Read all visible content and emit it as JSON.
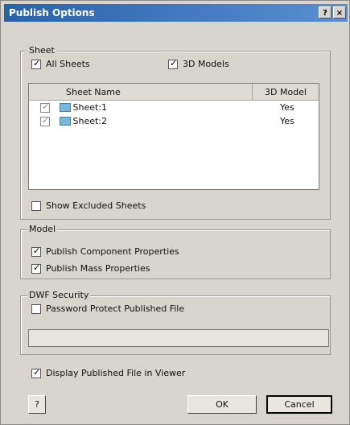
{
  "window": {
    "title": "Publish Options",
    "controls": [
      "?",
      "×"
    ]
  },
  "sheet_group": {
    "label": "Sheet",
    "all_sheets": {
      "label": "All Sheets",
      "checked": true
    },
    "models_3d": {
      "label": "3D Models",
      "checked": true
    },
    "columns": {
      "sheet_name": "Sheet Name",
      "model_3d": "3D Model"
    },
    "rows": [
      {
        "name": "Sheet:1",
        "model": "Yes"
      },
      {
        "name": "Sheet:2",
        "model": "Yes"
      }
    ],
    "show_excluded": {
      "label": "Show Excluded Sheets",
      "checked": false
    }
  },
  "model_group": {
    "label": "Model",
    "component_props": {
      "label": "Publish Component Properties",
      "checked": true
    },
    "mass_props": {
      "label": "Publish Mass Properties",
      "checked": true
    }
  },
  "security_group": {
    "label": "DWF Security",
    "password": {
      "label": "Password Protect Published File",
      "checked": false
    },
    "password_value": ""
  },
  "display_viewer": {
    "label": "Display Published File in Viewer",
    "checked": true
  },
  "buttons": {
    "help": "?",
    "ok": "OK",
    "cancel": "Cancel"
  }
}
